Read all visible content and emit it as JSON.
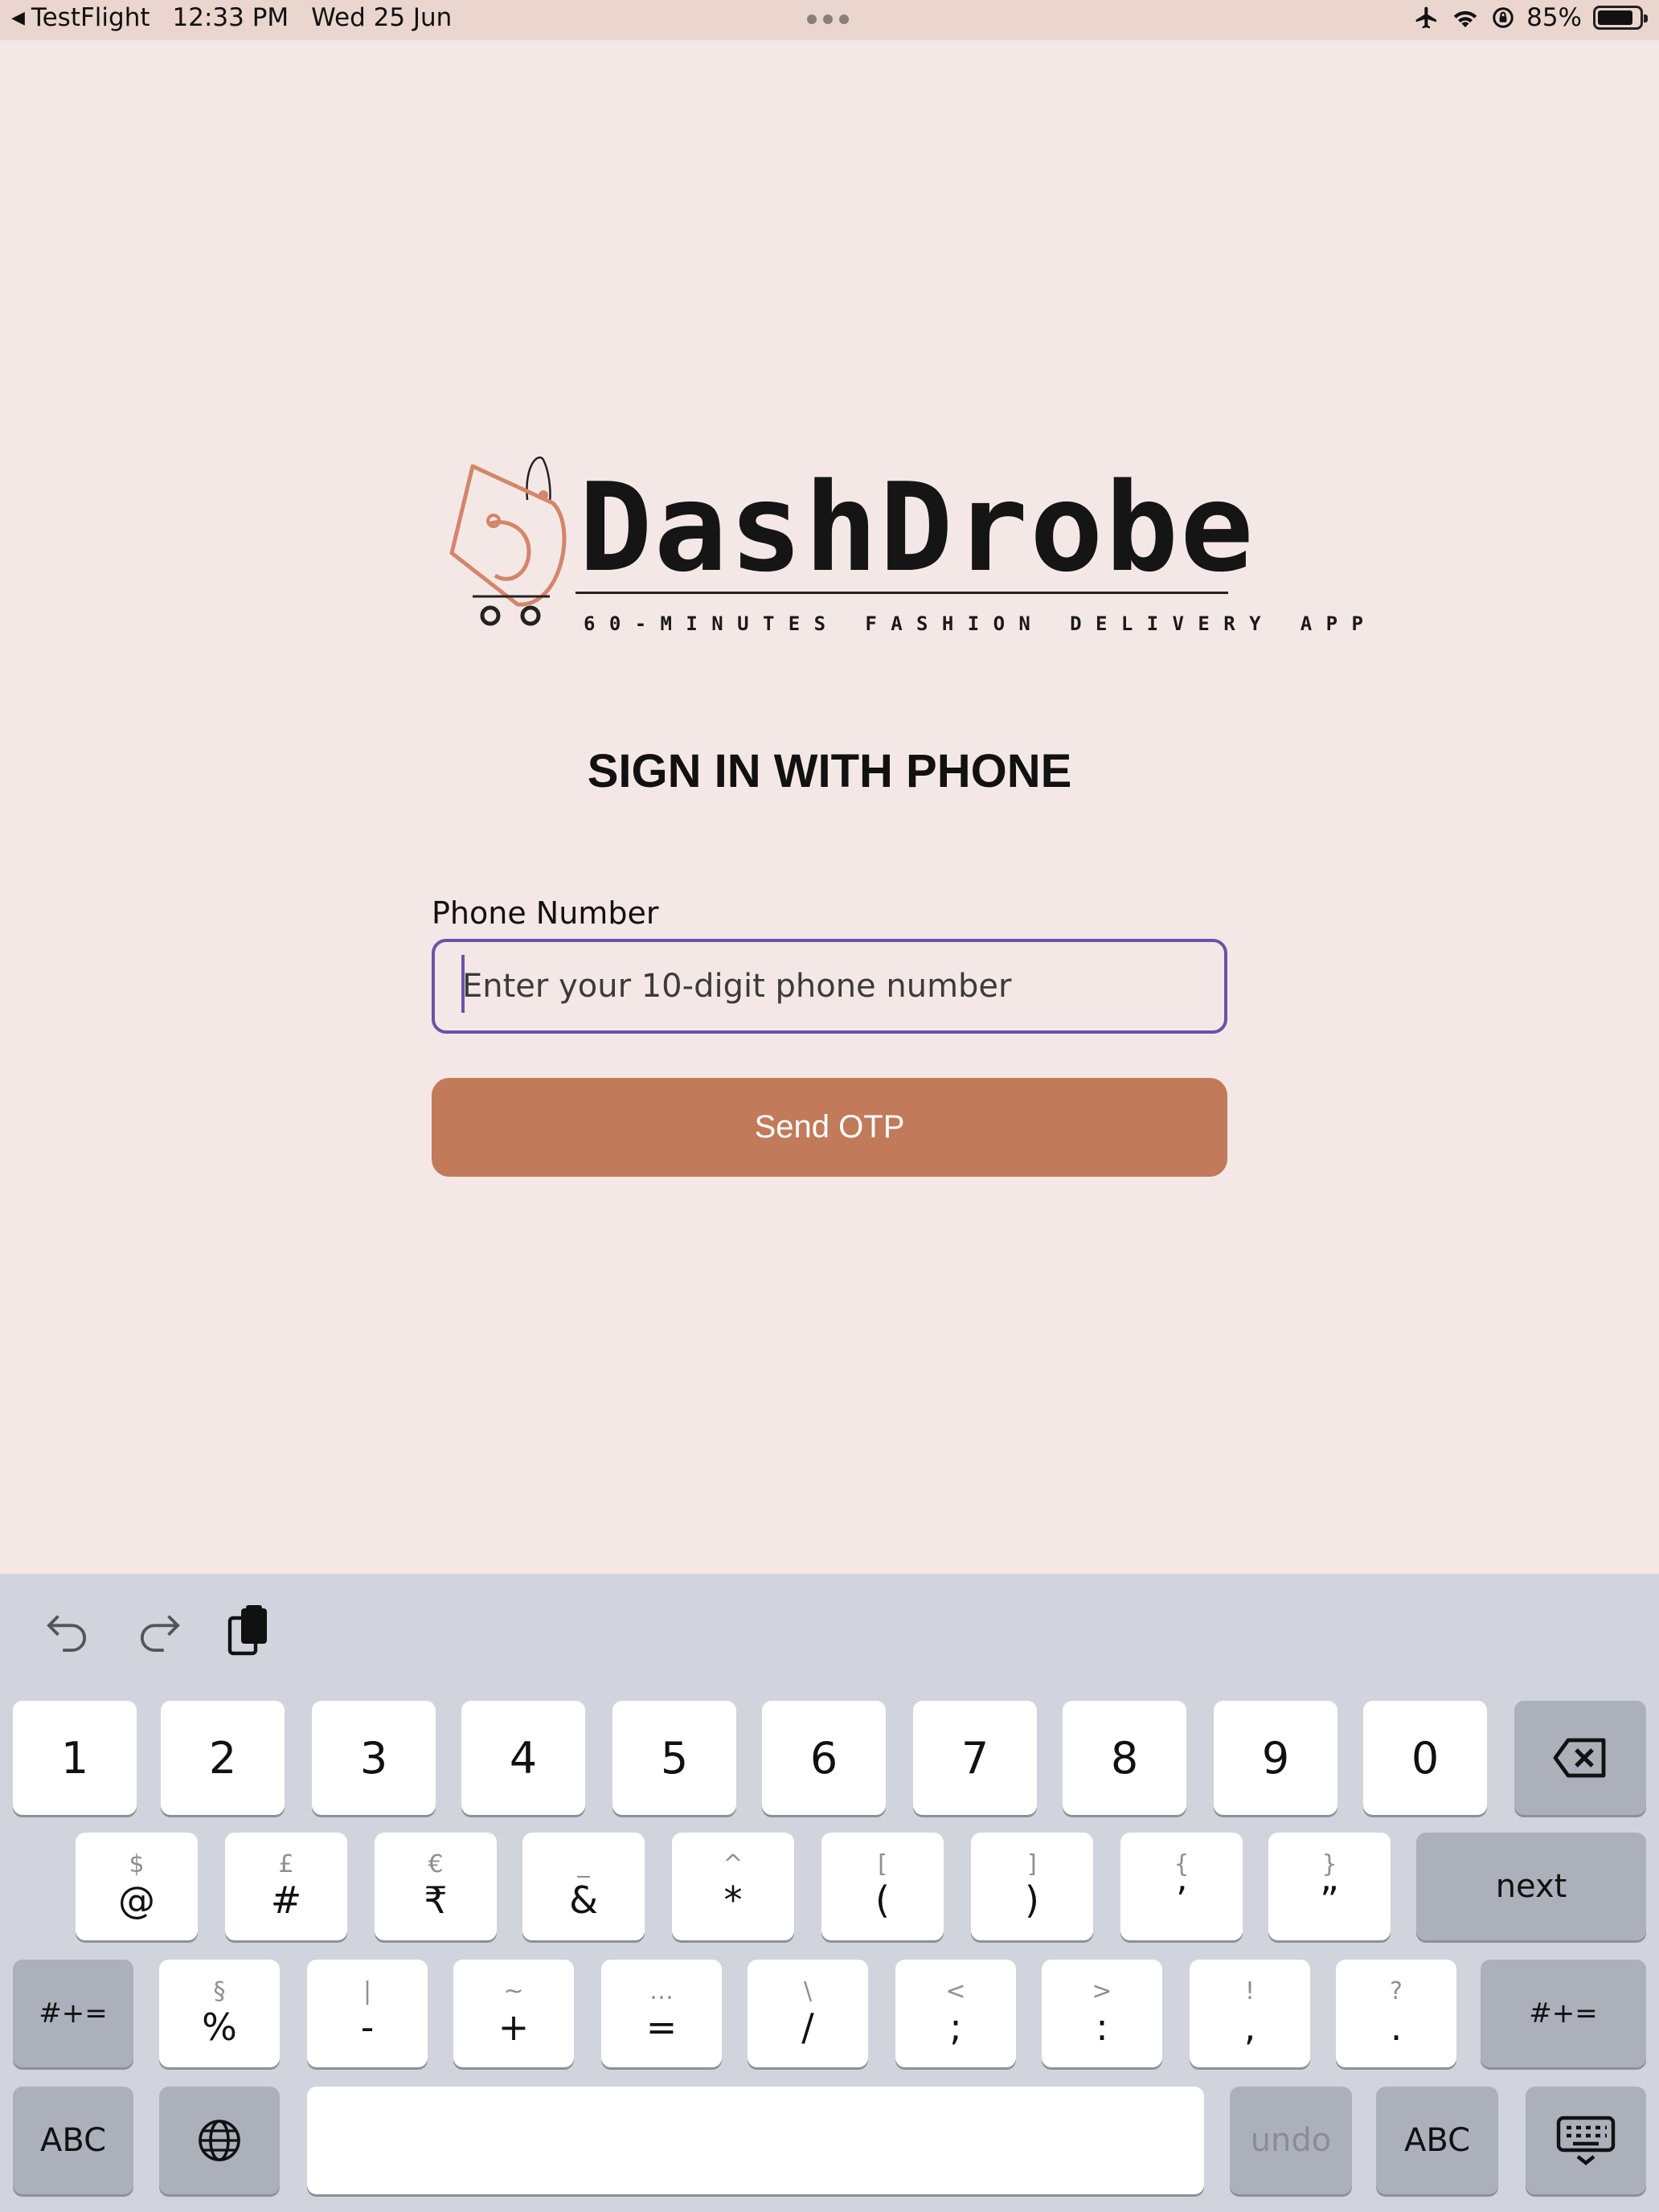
{
  "status_bar": {
    "back_app": "TestFlight",
    "time": "12:33 PM",
    "date": "Wed 25 Jun",
    "battery_percent": "85%",
    "battery_level": 0.85,
    "icons": [
      "airplane-icon",
      "wifi-icon",
      "orientation-lock-icon",
      "battery-icon"
    ]
  },
  "logo": {
    "brand_name": "DashDrobe",
    "tagline": "60-MINUTES FASHION DELIVERY APP",
    "colors": {
      "mark": "#d4856a",
      "text": "#151515"
    }
  },
  "form": {
    "heading": "SIGN IN WITH PHONE",
    "phone_label": "Phone Number",
    "phone_placeholder": "Enter your 10-digit phone number",
    "phone_value": "",
    "submit_label": "Send OTP"
  },
  "colors": {
    "background": "#f4e8e6",
    "accent_button": "#c17a5a",
    "focus_border": "#6b52a8",
    "keyboard_bg": "#d1d4dc"
  },
  "keyboard": {
    "toolbar": [
      "undo-icon",
      "redo-icon",
      "paste-icon"
    ],
    "row1": [
      "1",
      "2",
      "3",
      "4",
      "5",
      "6",
      "7",
      "8",
      "9",
      "0"
    ],
    "row2": [
      {
        "sec": "$",
        "pri": "@"
      },
      {
        "sec": "£",
        "pri": "#"
      },
      {
        "sec": "€",
        "pri": "₹"
      },
      {
        "sec": "_",
        "pri": "&"
      },
      {
        "sec": "^",
        "pri": "*"
      },
      {
        "sec": "[",
        "pri": "("
      },
      {
        "sec": "]",
        "pri": ")"
      },
      {
        "sec": "{",
        "pri": "’"
      },
      {
        "sec": "}",
        "pri": "”"
      }
    ],
    "row2_action": "next",
    "row3": [
      {
        "sec": "§",
        "pri": "%"
      },
      {
        "sec": "|",
        "pri": "-"
      },
      {
        "sec": "~",
        "pri": "+"
      },
      {
        "sec": "…",
        "pri": "="
      },
      {
        "sec": "\\",
        "pri": "/"
      },
      {
        "sec": "<",
        "pri": ";"
      },
      {
        "sec": ">",
        "pri": ":"
      },
      {
        "sec": "!",
        "pri": ","
      },
      {
        "sec": "?",
        "pri": "."
      }
    ],
    "shift_label": "#+=",
    "abc_label": "ABC",
    "undo_label": "undo"
  }
}
